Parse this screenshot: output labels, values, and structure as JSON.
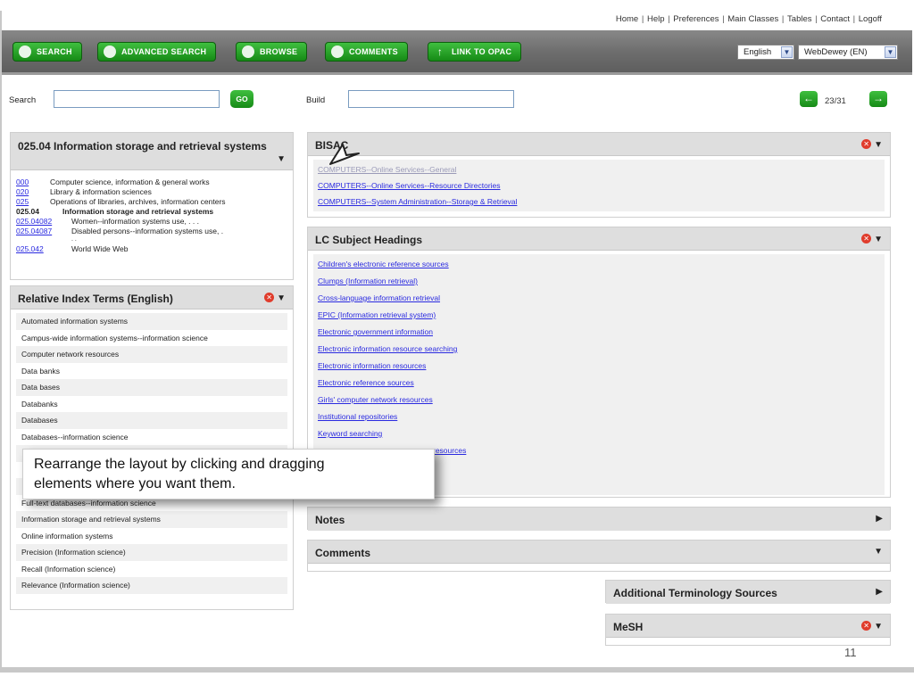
{
  "top_links": [
    "Home",
    "Help",
    "Preferences",
    "Main Classes",
    "Tables",
    "Contact",
    "Logoff"
  ],
  "toolbar": {
    "search": "SEARCH",
    "advanced_search": "ADVANCED SEARCH",
    "browse": "BROWSE",
    "comments": "COMMENTS",
    "link_to_opac": "LINK TO OPAC",
    "language": "English",
    "edition": "WebDewey (EN)"
  },
  "search": {
    "label": "Search",
    "value": "",
    "go": "GO"
  },
  "build": {
    "label": "Build",
    "value": ""
  },
  "pager": {
    "text": "23/31"
  },
  "hierarchy": {
    "title": "025.04 Information storage and retrieval systems",
    "rows": [
      {
        "code": "000",
        "text": "Computer science, information & general works"
      },
      {
        "code": "020",
        "text": "Library & information sciences"
      },
      {
        "code": "025",
        "text": "Operations of libraries, archives, information centers"
      },
      {
        "code": "025.04",
        "text": "Information storage and retrieval systems"
      },
      {
        "code": "025.04082",
        "text": "Women--information systems use, . . ."
      },
      {
        "code": "025.04087",
        "text": "Disabled persons--information systems use, ."
      },
      {
        "code": "",
        "text": ". ."
      },
      {
        "code": "025.042",
        "text": "World Wide Web"
      }
    ]
  },
  "relative_index": {
    "title": "Relative Index Terms (English)",
    "items": [
      "Automated information systems",
      "Campus-wide information systems--information science",
      "Computer network resources",
      "Data banks",
      "Data bases",
      "Databanks",
      "Databases",
      "Databases--information science",
      "",
      "",
      "",
      "Full-text databases--information science",
      "Information storage and retrieval systems",
      "Online information systems",
      "Precision (Information science)",
      "Recall (Information science)",
      "Relevance (Information science)"
    ]
  },
  "bisac": {
    "title": "BISAC",
    "items": [
      "COMPUTERS--Online Services--General",
      "COMPUTERS--Online Services--Resource Directories",
      "COMPUTERS--System Administration--Storage & Retrieval"
    ]
  },
  "lcsh": {
    "title": "LC Subject Headings",
    "items": [
      "Children's electronic reference sources",
      "Clumps (Information retrieval)",
      "Cross-language information retrieval",
      "EPIC (Information retrieval system)",
      "Electronic government information",
      "Electronic information resource searching",
      "Electronic information resources",
      "Electronic reference sources",
      "Girls' computer network resources",
      "Institutional repositories",
      "Keyword searching",
      "resources"
    ]
  },
  "notes": {
    "title": "Notes"
  },
  "comments": {
    "title": "Comments"
  },
  "additional": {
    "title": "Additional Terminology Sources"
  },
  "mesh": {
    "title": "MeSH"
  },
  "tooltip": {
    "line1": "Rearrange the layout by clicking and dragging",
    "line2": "elements where you want them."
  },
  "slide_number": "11",
  "colors": {
    "accent_green": "#22a022",
    "link_blue": "#2a2ae0",
    "close_red": "#e03c2c"
  }
}
